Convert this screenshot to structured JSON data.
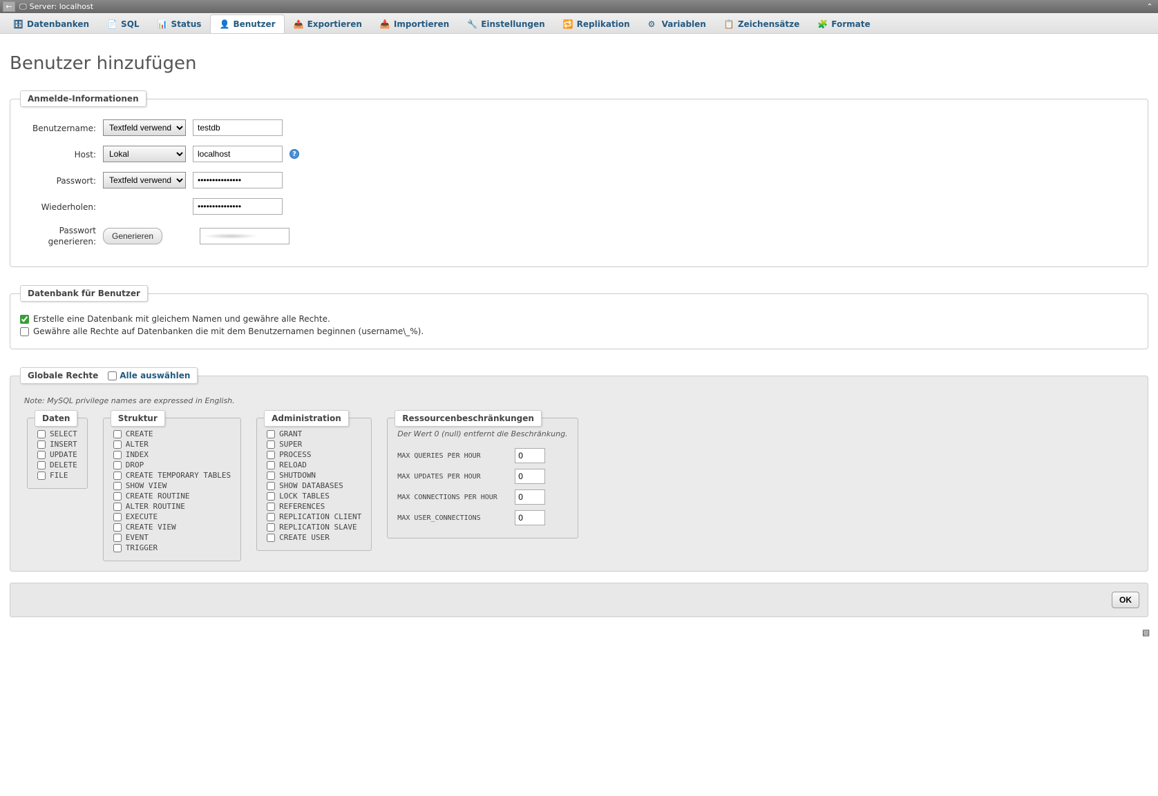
{
  "topbar": {
    "server_label": "Server: localhost"
  },
  "tabs": [
    {
      "icon": "db",
      "label": "Datenbanken"
    },
    {
      "icon": "sql",
      "label": "SQL"
    },
    {
      "icon": "status",
      "label": "Status"
    },
    {
      "icon": "user",
      "label": "Benutzer",
      "active": true
    },
    {
      "icon": "export",
      "label": "Exportieren"
    },
    {
      "icon": "import",
      "label": "Importieren"
    },
    {
      "icon": "settings",
      "label": "Einstellungen"
    },
    {
      "icon": "replication",
      "label": "Replikation"
    },
    {
      "icon": "vars",
      "label": "Variablen"
    },
    {
      "icon": "charset",
      "label": "Zeichensätze"
    },
    {
      "icon": "formats",
      "label": "Formate"
    }
  ],
  "page_title": "Benutzer hinzufügen",
  "login_legend": "Anmelde-Informationen",
  "fields": {
    "username": {
      "label": "Benutzername:",
      "mode": "Textfeld verwenden:",
      "value": "testdb"
    },
    "host": {
      "label": "Host:",
      "mode": "Lokal",
      "value": "localhost"
    },
    "password": {
      "label": "Passwort:",
      "mode": "Textfeld verwenden:",
      "value": "•••••••••••••••"
    },
    "repeat": {
      "label": "Wiederholen:",
      "value": "•••••••••••••••"
    },
    "generate": {
      "label": "Passwort generieren:",
      "button": "Generieren"
    }
  },
  "db_for_user": {
    "legend": "Datenbank für Benutzer",
    "opt1": "Erstelle eine Datenbank mit gleichem Namen und gewähre alle Rechte.",
    "opt2": "Gewähre alle Rechte auf Datenbanken die mit dem Benutzernamen beginnen (username\\_%)."
  },
  "global": {
    "legend": "Globale Rechte",
    "select_all": "Alle auswählen",
    "note": "Note: MySQL privilege names are expressed in English.",
    "data": {
      "legend": "Daten",
      "items": [
        "SELECT",
        "INSERT",
        "UPDATE",
        "DELETE",
        "FILE"
      ]
    },
    "struct": {
      "legend": "Struktur",
      "items": [
        "CREATE",
        "ALTER",
        "INDEX",
        "DROP",
        "CREATE TEMPORARY TABLES",
        "SHOW VIEW",
        "CREATE ROUTINE",
        "ALTER ROUTINE",
        "EXECUTE",
        "CREATE VIEW",
        "EVENT",
        "TRIGGER"
      ]
    },
    "admin": {
      "legend": "Administration",
      "items": [
        "GRANT",
        "SUPER",
        "PROCESS",
        "RELOAD",
        "SHUTDOWN",
        "SHOW DATABASES",
        "LOCK TABLES",
        "REFERENCES",
        "REPLICATION CLIENT",
        "REPLICATION SLAVE",
        "CREATE USER"
      ]
    },
    "res": {
      "legend": "Ressourcenbeschränkungen",
      "note": "Der Wert 0 (null) entfernt die Beschränkung.",
      "items": [
        {
          "label": "MAX QUERIES PER HOUR",
          "value": "0"
        },
        {
          "label": "MAX UPDATES PER HOUR",
          "value": "0"
        },
        {
          "label": "MAX CONNECTIONS PER HOUR",
          "value": "0"
        },
        {
          "label": "MAX USER_CONNECTIONS",
          "value": "0"
        }
      ]
    }
  },
  "ok": "OK"
}
